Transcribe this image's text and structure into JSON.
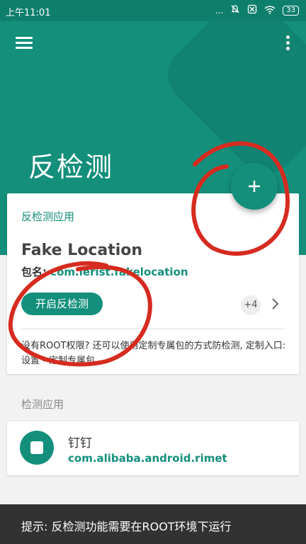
{
  "status_bar": {
    "time": "上午11:01",
    "dots": "...",
    "battery": "33"
  },
  "header": {
    "title": "反检测"
  },
  "anti_detect_card": {
    "section_label": "反检测应用",
    "app_name": "Fake Location",
    "package_label": "包名:",
    "package_name": "com.lerist.fakelocation",
    "toggle_button": "开启反检测",
    "extra_count": "+4",
    "hint": "没有ROOT权限? 还可以使用定制专属包的方式防检测, 定制入口: 设置 - 定制专属包"
  },
  "detect_section": {
    "label": "检测应用",
    "apps": [
      {
        "name": "钉钉",
        "package": "com.alibaba.android.rimet"
      }
    ]
  },
  "snackbar": {
    "message": "提示: 反检测功能需要在ROOT环境下运行"
  },
  "colors": {
    "primary": "#138f7c",
    "status_bar": "#0f7f6d",
    "annotation": "#d62b20"
  }
}
